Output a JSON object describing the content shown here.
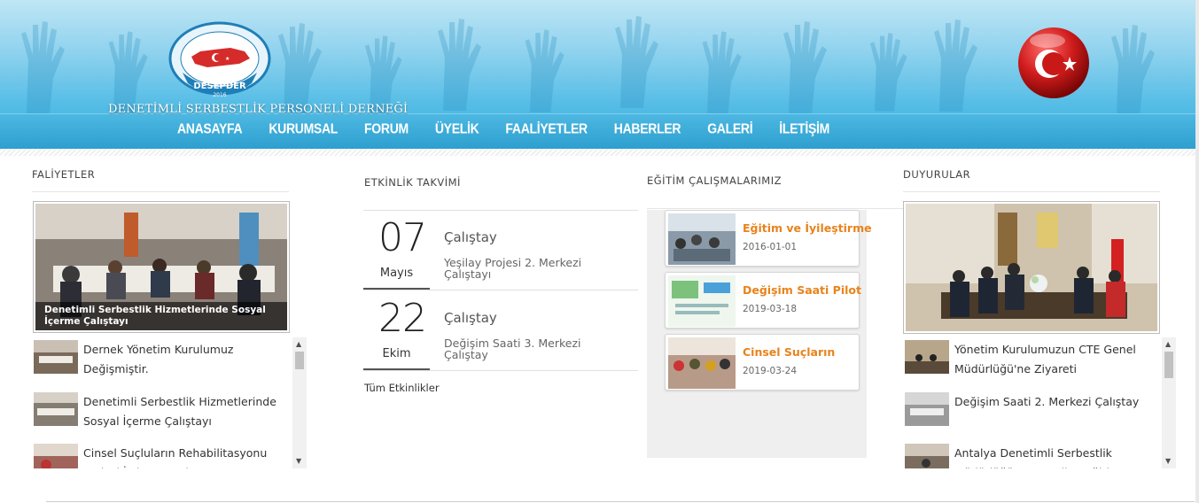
{
  "header": {
    "site_name": "DENETİMLİ SERBESTLİK PERSONELİ DERNEĞİ",
    "logo_ring_text": "DENETİMLİ SERBESTLİK PERSONELİ DERNEĞİ",
    "logo_badge": "DESEPDER",
    "logo_year": "2016",
    "nav": [
      "ANASAYFA",
      "KURUMSAL",
      "FORUM",
      "ÜYELİK",
      "FAALİYETLER",
      "HABERLER",
      "GALERİ",
      "İLETİŞİM"
    ]
  },
  "faaliyetler": {
    "title": "FALİYETLER",
    "featured_caption": "Denetimli Serbestlik Hizmetlerinde Sosyal İçerme Çalıştayı",
    "items": [
      {
        "text": "Dernek Yönetim Kurulumuz Değişmiştir."
      },
      {
        "text": "Denetimli Serbestlik Hizmetlerinde Sosyal İçerme Çalıştayı"
      },
      {
        "text": "Cinsel Suçluların Rehabilitasyonu Projesi İstişare Toplantısı"
      }
    ]
  },
  "etkinlik": {
    "title": "ETKİNLİK TAKVİMİ",
    "events": [
      {
        "day": "07",
        "month": "Mayıs",
        "type": "Çalıştay",
        "desc": "Yeşilay Projesi 2. Merkezi Çalıştayı"
      },
      {
        "day": "22",
        "month": "Ekim",
        "type": "Çalıştay",
        "desc": "Değişim Saati 3. Merkezi Çalıştay"
      }
    ],
    "all_label": "Tüm Etkinlikler"
  },
  "egitim": {
    "title": "EĞİTİM ÇALIŞMALARIMIZ",
    "cards": [
      {
        "title": "Eğitim ve İyileştirme",
        "date": "2016-01-01"
      },
      {
        "title": "Değişim Saati Pilot",
        "date": "2019-03-18"
      },
      {
        "title": "Cinsel Suçların",
        "date": "2019-03-24"
      }
    ]
  },
  "duyurular": {
    "title": "DUYURULAR",
    "items": [
      {
        "text": "Yönetim Kurulumuzun CTE Genel Müdürlüğü'ne Ziyareti"
      },
      {
        "text": "Değişim Saati 2. Merkezi Çalıştay"
      },
      {
        "text": "Antalya Denetimli Serbestlik Müdürlüğü Personeline Eğitim"
      }
    ]
  },
  "colors": {
    "accent_orange": "#e8831c",
    "header_blue": "#3aafdc",
    "nav_band": "#2d9fcf"
  }
}
